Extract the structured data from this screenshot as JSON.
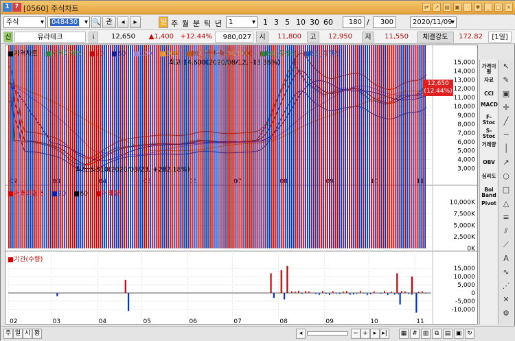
{
  "window": {
    "badge_1": "1",
    "badge_2": "?",
    "title": "[0560] 주식차트"
  },
  "toolbar": {
    "market": "주식",
    "code": "048430",
    "search_label": "관",
    "periods": [
      "일",
      "주",
      "월",
      "분",
      "틱",
      "년"
    ],
    "interval_value": "1",
    "interval_buttons": [
      "1",
      "3",
      "5",
      "10",
      "30",
      "60"
    ],
    "view_count": "180",
    "view_total": "300",
    "date": "2020/11/09"
  },
  "quote": {
    "sin_label": "신",
    "name": "유라테크",
    "info_label": "i",
    "price": "12,650",
    "change": "▲1,400",
    "change_pct": "+12.44%",
    "volume": "980,027",
    "open_label": "시",
    "open": "11,800",
    "high_label": "고",
    "high": "12,950",
    "low_label": "저",
    "low": "11,550",
    "strength_label": "체결강도",
    "strength": "172.82",
    "period_label": "[1일]"
  },
  "legend_price": {
    "title": "가격차트",
    "ma_title": "가격이평 5",
    "ma20": "20",
    "ma60": "60",
    "ma120": "120",
    "ma200": "200",
    "bb_upper": "BB_상한선(20,2.00)",
    "bb_mid": "BB_중심선",
    "bb_lower": "BB_하한선"
  },
  "annotations": {
    "high": "최고:14,600(2020/08/12, -13.36%)",
    "low": "최저:3,310(2020/03/23, +282.18%)",
    "last_price": "12,650",
    "last_pct": "(12.44%)"
  },
  "legend_volume": {
    "title": "거래이평 5",
    "ma20": "20",
    "ma60": "60",
    "series": "거래량"
  },
  "legend_inst": {
    "title": "기관(수량)"
  },
  "axes": {
    "months": [
      "02",
      "03",
      "04",
      "05",
      "06",
      "07",
      "08",
      "09",
      "10",
      "11"
    ],
    "price_ticks": [
      "15,000",
      "14,000",
      "13,000",
      "12,000",
      "11,000",
      "10,000",
      "9,000",
      "8,000",
      "7,000",
      "6,000",
      "5,000",
      "4,000",
      "3,000"
    ],
    "volume_ticks": [
      "10,000K",
      "7,500K",
      "5,000K",
      "2,500K",
      "0K"
    ],
    "inst_ticks": [
      "15,000",
      "10,000",
      "5,000",
      "0",
      "-5,000",
      "-10,000"
    ]
  },
  "chart_data": {
    "type": "line",
    "x_range": [
      "2020/02",
      "2020/11/09"
    ],
    "price_ylim": [
      2500,
      15500
    ],
    "price_points": [
      [
        "02/03",
        6200
      ],
      [
        "02/17",
        6000
      ],
      [
        "03/02",
        5400
      ],
      [
        "03/09",
        4600
      ],
      [
        "03/16",
        3600
      ],
      [
        "03/23",
        3310
      ],
      [
        "04/01",
        4300
      ],
      [
        "04/13",
        5300
      ],
      [
        "04/27",
        5600
      ],
      [
        "05/11",
        5800
      ],
      [
        "05/25",
        5700
      ],
      [
        "06/08",
        6200
      ],
      [
        "06/22",
        5900
      ],
      [
        "07/06",
        6000
      ],
      [
        "07/17",
        6200
      ],
      [
        "07/24",
        8000
      ],
      [
        "07/31",
        11000
      ],
      [
        "08/07",
        13200
      ],
      [
        "08/12",
        14600
      ],
      [
        "08/20",
        12600
      ],
      [
        "08/31",
        11300
      ],
      [
        "09/10",
        11800
      ],
      [
        "09/21",
        12100
      ],
      [
        "10/01",
        10800
      ],
      [
        "10/12",
        10200
      ],
      [
        "10/22",
        11200
      ],
      [
        "11/02",
        11300
      ],
      [
        "11/09",
        12650
      ]
    ],
    "volume_ylim": [
      0,
      11000
    ],
    "volume_points_k": [
      [
        "02/15",
        150
      ],
      [
        "03/20",
        400
      ],
      [
        "04/24",
        450
      ],
      [
        "05/15",
        900
      ],
      [
        "06/15",
        250
      ],
      [
        "07/24",
        3500
      ],
      [
        "07/27",
        10400
      ],
      [
        "07/30",
        8700
      ],
      [
        "08/12",
        2800
      ],
      [
        "09/15",
        400
      ],
      [
        "10/20",
        1300
      ],
      [
        "11/09",
        980
      ]
    ],
    "inst_ylim": [
      -13000,
      18000
    ],
    "inst_points": [
      [
        "03/05",
        -2000
      ],
      [
        "04/20",
        8000
      ],
      [
        "04/22",
        -11000
      ],
      [
        "07/27",
        12000
      ],
      [
        "07/29",
        -3000
      ],
      [
        "08/03",
        14000
      ],
      [
        "08/05",
        -4000
      ],
      [
        "08/07",
        16500
      ],
      [
        "10/20",
        12000
      ],
      [
        "10/22",
        -7000
      ],
      [
        "10/30",
        10000
      ],
      [
        "11/02",
        -12000
      ]
    ]
  },
  "palette": [
    "가격이평",
    "자료",
    "CCI",
    "MACD",
    "F-Stoc",
    "S-Stoc",
    "거래량",
    "OBV",
    "심리도",
    "Bol Band",
    "Pivot"
  ],
  "bottom": {
    "btn_left": "주",
    "btn_mid": "일",
    "btn_right": "시",
    "btn_end": "황"
  },
  "colors": {
    "up": "#d00000",
    "down": "#0033cc",
    "bb_upper": "#c05a10",
    "bb_mid": "#2a8a2a",
    "bb_lower": "#1a5ab8"
  }
}
